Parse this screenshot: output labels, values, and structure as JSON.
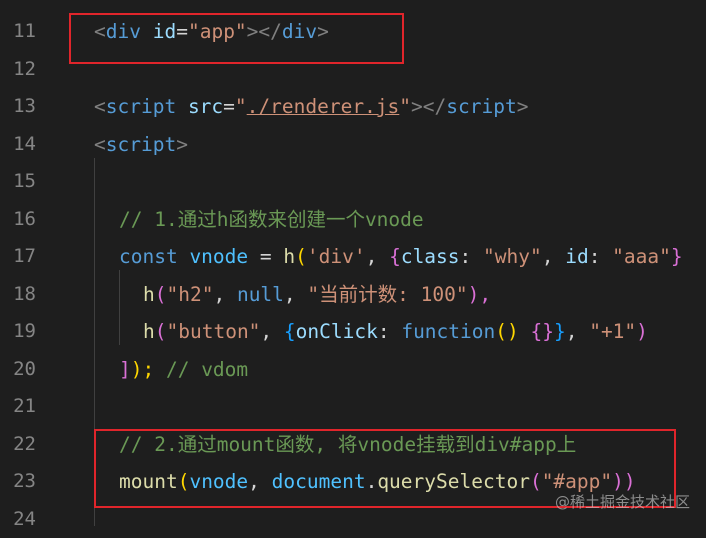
{
  "editor": {
    "lines": [
      {
        "number": "11",
        "tokens": [
          "<",
          "div",
          " id",
          "=",
          "\"app\"",
          "></",
          "div",
          ">"
        ]
      },
      {
        "number": "12"
      },
      {
        "number": "13",
        "tokens": [
          "<",
          "script",
          " src",
          "=",
          "\"",
          "./renderer.js",
          "\"",
          "></",
          "script",
          ">"
        ]
      },
      {
        "number": "14",
        "tokens": [
          "<",
          "script",
          ">"
        ]
      },
      {
        "number": "15"
      },
      {
        "number": "16",
        "tokens": [
          "// 1.通过h函数来创建一个vnode"
        ]
      },
      {
        "number": "17",
        "tokens": [
          "const",
          " vnode",
          " = ",
          "h",
          "(",
          "'div'",
          ", ",
          "{",
          "class",
          ": ",
          "\"why\"",
          ", ",
          "id",
          ": ",
          "\"aaa\"",
          "}"
        ]
      },
      {
        "number": "18",
        "tokens": [
          "h",
          "(",
          "\"h2\"",
          ", ",
          "null",
          ", ",
          "\"当前计数: 100\"",
          "),"
        ]
      },
      {
        "number": "19",
        "tokens": [
          "h",
          "(",
          "\"button\"",
          ", ",
          "{",
          "onClick",
          ": ",
          "function",
          "()",
          " ",
          "{}",
          "}",
          ", ",
          "\"+1\"",
          ")"
        ]
      },
      {
        "number": "20",
        "tokens": [
          "]",
          ");",
          " // vdom"
        ]
      },
      {
        "number": "21"
      },
      {
        "number": "22",
        "tokens": [
          "// 2.通过mount函数, 将vnode挂载到div#app上"
        ]
      },
      {
        "number": "23",
        "tokens": [
          "mount",
          "(",
          "vnode",
          ", ",
          "document",
          ".",
          "querySelector",
          "(",
          "\"#app\"",
          "))"
        ]
      },
      {
        "number": "24"
      }
    ]
  },
  "watermark": "@稀土掘金技术社区",
  "colors": {
    "background": "#1e1e1e",
    "highlight_box": "#e0252b"
  }
}
